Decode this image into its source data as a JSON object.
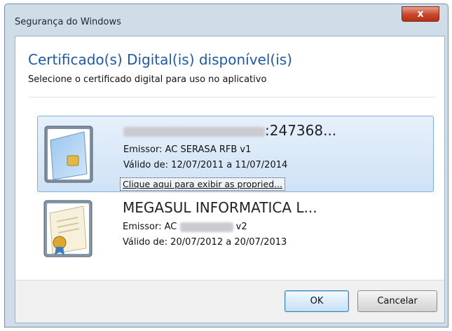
{
  "window": {
    "title": "Segurança do Windows",
    "close_label": "x"
  },
  "dialog": {
    "heading": "Certificado(s) Digital(is) disponível(is)",
    "subheading": "Selecione o certificado digital para uso no aplicativo"
  },
  "certificates": [
    {
      "name_suffix": ":247368...",
      "issuer": "Emissor: AC SERASA RFB v1",
      "validity": "Válido de: 12/07/2011 a 11/07/2014",
      "link": "Clique aqui para exibir as propried..."
    },
    {
      "name": "MEGASUL INFORMATICA L...",
      "issuer_prefix": "Emissor: AC",
      "issuer_suffix": "v2",
      "validity": "Válido de: 20/07/2012 a 20/07/2013"
    }
  ],
  "buttons": {
    "ok": "OK",
    "cancel": "Cancelar"
  }
}
